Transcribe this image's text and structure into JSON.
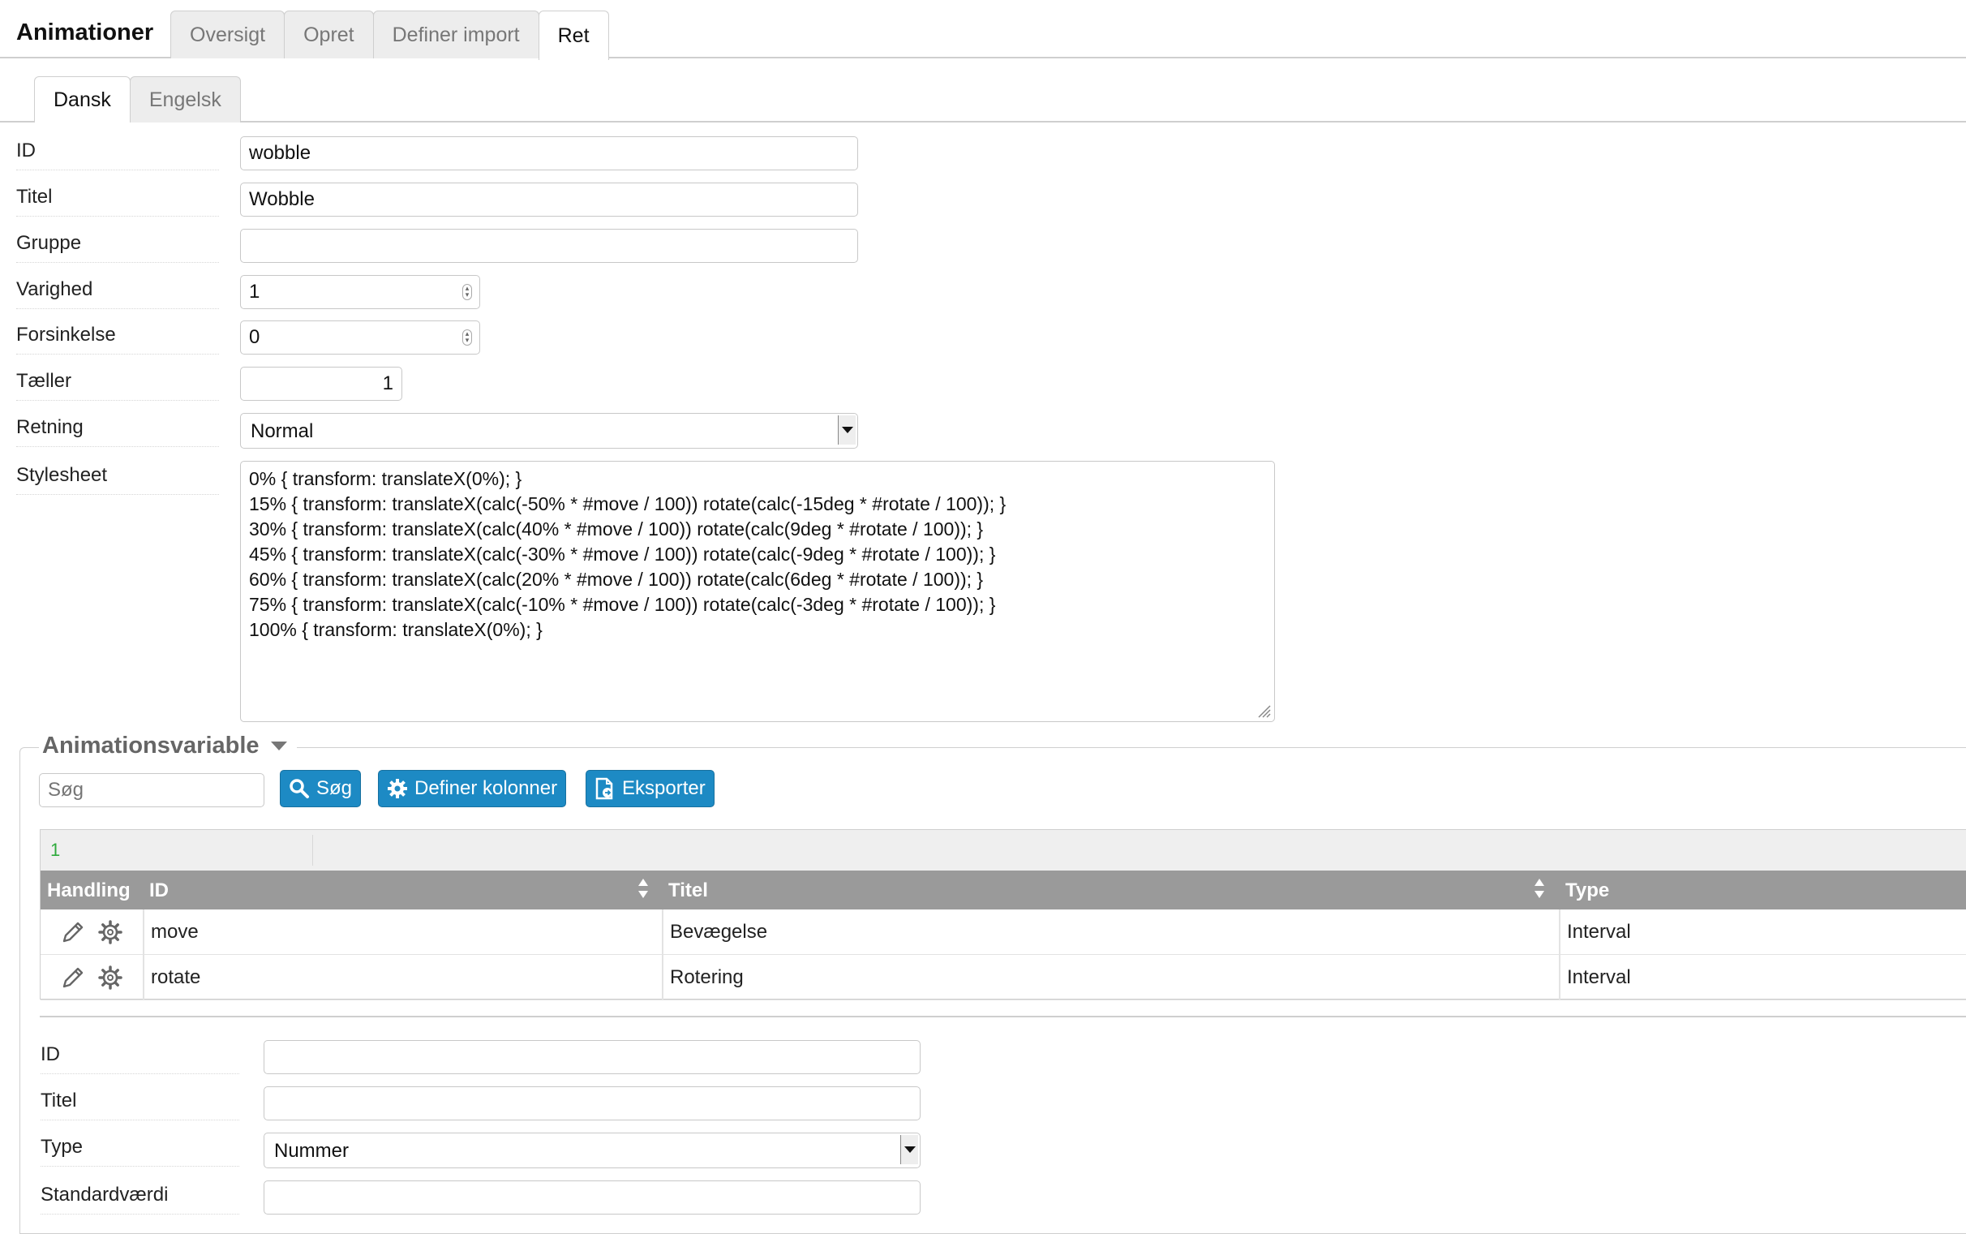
{
  "app": {
    "title": "Animationer"
  },
  "top_tabs": [
    {
      "label": "Oversigt",
      "active": false
    },
    {
      "label": "Opret",
      "active": false
    },
    {
      "label": "Definer import",
      "active": false
    },
    {
      "label": "Ret",
      "active": true
    }
  ],
  "lang_tabs": [
    {
      "label": "Dansk",
      "active": true
    },
    {
      "label": "Engelsk",
      "active": false
    }
  ],
  "form": {
    "id": {
      "label": "ID",
      "value": "wobble"
    },
    "titel": {
      "label": "Titel",
      "value": "Wobble"
    },
    "gruppe": {
      "label": "Gruppe",
      "value": ""
    },
    "varighed": {
      "label": "Varighed",
      "value": "1"
    },
    "forsinkelse": {
      "label": "Forsinkelse",
      "value": "0"
    },
    "taeller": {
      "label": "Tæller",
      "value": "1"
    },
    "retning": {
      "label": "Retning",
      "value": "Normal"
    },
    "stylesheet": {
      "label": "Stylesheet",
      "value": "0% { transform: translateX(0%); }\n15% { transform: translateX(calc(-50% * #move / 100)) rotate(calc(-15deg * #rotate / 100)); }\n30% { transform: translateX(calc(40% * #move / 100)) rotate(calc(9deg * #rotate / 100)); }\n45% { transform: translateX(calc(-30% * #move / 100)) rotate(calc(-9deg * #rotate / 100)); }\n60% { transform: translateX(calc(20% * #move / 100)) rotate(calc(6deg * #rotate / 100)); }\n75% { transform: translateX(calc(-10% * #move / 100)) rotate(calc(-3deg * #rotate / 100)); }\n100% { transform: translateX(0%); }"
    }
  },
  "variables": {
    "legend": "Animationsvariable",
    "search_placeholder": "Søg",
    "buttons": {
      "search": "Søg",
      "define_columns": "Definer kolonner",
      "export": "Eksporter"
    },
    "page": "1",
    "columns": {
      "action": "Handling",
      "id": "ID",
      "title": "Titel",
      "type": "Type"
    },
    "rows": [
      {
        "id": "move",
        "title": "Bevægelse",
        "type": "Interval"
      },
      {
        "id": "rotate",
        "title": "Rotering",
        "type": "Interval"
      }
    ]
  },
  "subform": {
    "id": {
      "label": "ID",
      "value": ""
    },
    "titel": {
      "label": "Titel",
      "value": ""
    },
    "type": {
      "label": "Type",
      "value": "Nummer"
    },
    "standardvaerdi": {
      "label": "Standardværdi",
      "value": ""
    }
  },
  "colors": {
    "accent": "#1d8ac4",
    "header_gray": "#9a9a9a",
    "page_green": "#2eaa3c"
  }
}
